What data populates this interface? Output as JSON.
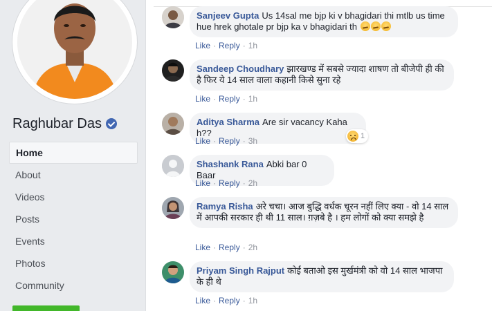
{
  "page": {
    "name": "Raghubar Das",
    "verified_icon": "verified-badge-icon"
  },
  "nav": {
    "items": [
      {
        "label": "Home",
        "active": true
      },
      {
        "label": "About"
      },
      {
        "label": "Videos"
      },
      {
        "label": "Posts"
      },
      {
        "label": "Events"
      },
      {
        "label": "Photos"
      },
      {
        "label": "Community"
      }
    ]
  },
  "actions": {
    "like": "Like",
    "reply": "Reply",
    "separator": "·"
  },
  "comments": [
    {
      "author": "Sanjeev Gupta",
      "text": "Us 14sal me bjp ki v bhagidari thi mtlb us time hue hrek ghotale pr bjp ka v bhagidari th",
      "emoji_count": 3,
      "time": "1h",
      "avatar_color": "#6b5e55"
    },
    {
      "author": "Sandeep Choudhary",
      "text": "झारखण्ड में सबसे ज्यादा शाषण तो बीजेपी ही की है फिर ये 14 साल वाला कहानी किसे सुना रहे",
      "time": "1h",
      "avatar_color": "#2b2b2b"
    },
    {
      "author": "Aditya Sharma",
      "text": "Are sir vacancy Kaha h??",
      "time": "3h",
      "reaction_count": "1",
      "reaction_icon": "sad-reaction-icon",
      "avatar_color": "#8a7460"
    },
    {
      "author": "Shashank Rana",
      "text": "Abki bar 0 Baar",
      "time": "2h",
      "avatar_color": "#c9ccd1"
    },
    {
      "author": "Ramya Risha",
      "text": "अरे चचा। आज बुद्धि वर्धक चूरन नहीं लिए क्या - वो 14 साल में आपकी सरकार ही थी 11 साल। ग़ज़बे है । हम लोगों को क्या समझे है",
      "time": "2h",
      "avatar_color": "#5a4a50"
    },
    {
      "author": "Priyam Singh Rajput",
      "text": "कोई बताओ इस मुर्खमंत्री को वो 14 साल भाजपा के ही थे",
      "time": "1h",
      "avatar_color": "#3f7a5a"
    }
  ]
}
